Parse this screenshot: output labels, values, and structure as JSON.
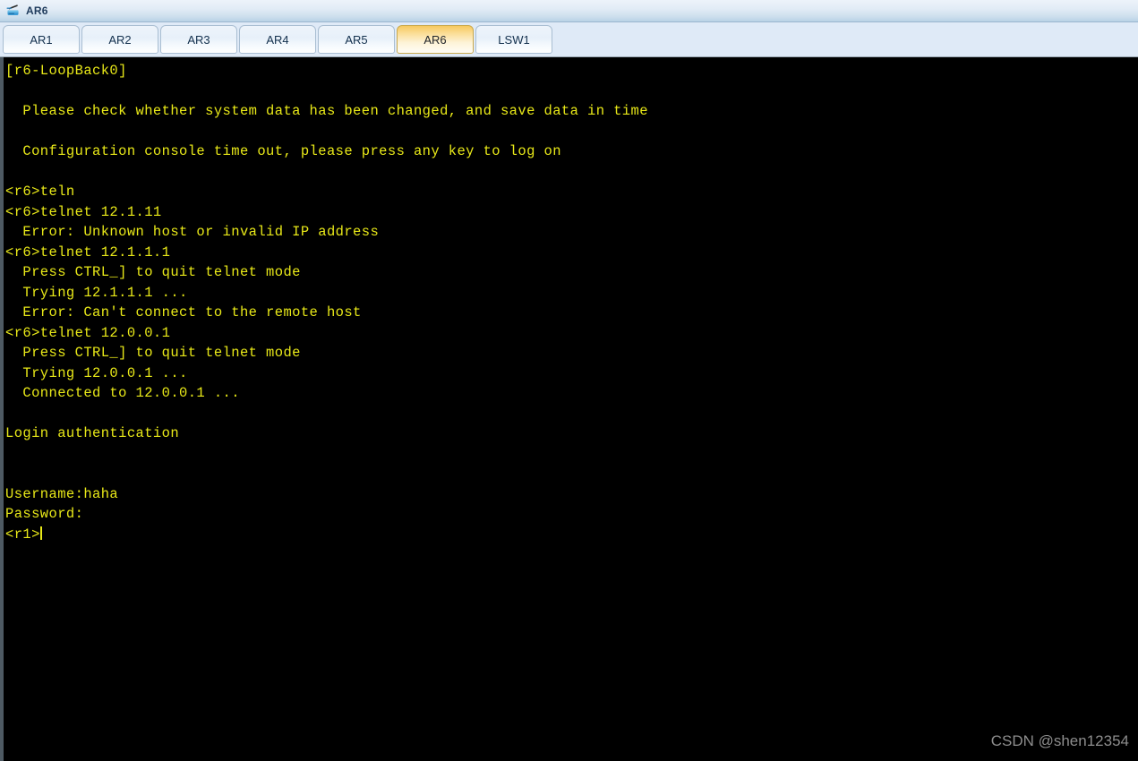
{
  "window": {
    "title": "AR6",
    "icon": "router-icon"
  },
  "tabs": {
    "items": [
      {
        "label": "AR1",
        "active": false
      },
      {
        "label": "AR2",
        "active": false
      },
      {
        "label": "AR3",
        "active": false
      },
      {
        "label": "AR4",
        "active": false
      },
      {
        "label": "AR5",
        "active": false
      },
      {
        "label": "AR6",
        "active": true
      },
      {
        "label": "LSW1",
        "active": false
      }
    ]
  },
  "terminal": {
    "foreground_color": "#e8e818",
    "background_color": "#000000",
    "lines": [
      "[r6-LoopBack0]",
      "",
      "  Please check whether system data has been changed, and save data in time",
      "",
      "  Configuration console time out, please press any key to log on",
      "",
      "<r6>teln",
      "<r6>telnet 12.1.11",
      "  Error: Unknown host or invalid IP address",
      "<r6>telnet 12.1.1.1",
      "  Press CTRL_] to quit telnet mode",
      "  Trying 12.1.1.1 ...",
      "  Error: Can't connect to the remote host",
      "<r6>telnet 12.0.0.1",
      "  Press CTRL_] to quit telnet mode",
      "  Trying 12.0.0.1 ...",
      "  Connected to 12.0.0.1 ...",
      "",
      "Login authentication",
      "",
      "",
      "Username:haha",
      "Password:",
      "<r1>"
    ],
    "cursor_line_index": 23
  },
  "watermark": {
    "text": "CSDN @shen12354"
  }
}
